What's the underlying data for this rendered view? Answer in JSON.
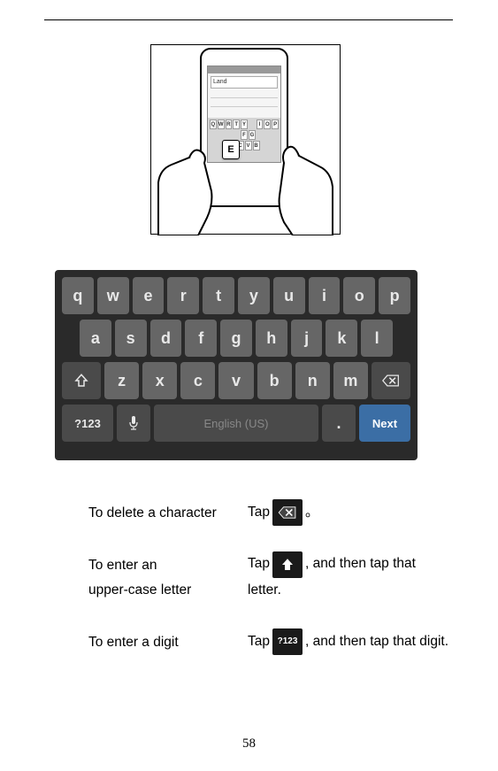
{
  "illustration": {
    "typed_text": "Land",
    "popup_key": "E",
    "visible_keys_row1": [
      "Q",
      "W",
      "R",
      "T",
      "Y",
      "I",
      "O",
      "P"
    ],
    "visible_keys_row2": [
      "F",
      "G"
    ],
    "visible_keys_row3": [
      "C",
      "V",
      "B"
    ]
  },
  "keyboard": {
    "row1": [
      "q",
      "w",
      "e",
      "r",
      "t",
      "y",
      "u",
      "i",
      "o",
      "p"
    ],
    "row2": [
      "a",
      "s",
      "d",
      "f",
      "g",
      "h",
      "j",
      "k",
      "l"
    ],
    "row3": [
      "z",
      "x",
      "c",
      "v",
      "b",
      "n",
      "m"
    ],
    "numkey": "?123",
    "space": "English (US)",
    "dot": ".",
    "next": "Next"
  },
  "instructions": {
    "delete": {
      "left": "To delete a character",
      "pre": "Tap ",
      "post": "。"
    },
    "upper": {
      "left1": "To enter an",
      "left2": "upper-case letter",
      "pre": "Tap",
      "mid": " , and then tap that ",
      "post": "letter."
    },
    "digit": {
      "left": "To enter a digit",
      "pre": "Tap",
      "post": ", and then tap that digit.",
      "icon_label": "?123"
    }
  },
  "page_number": "58"
}
